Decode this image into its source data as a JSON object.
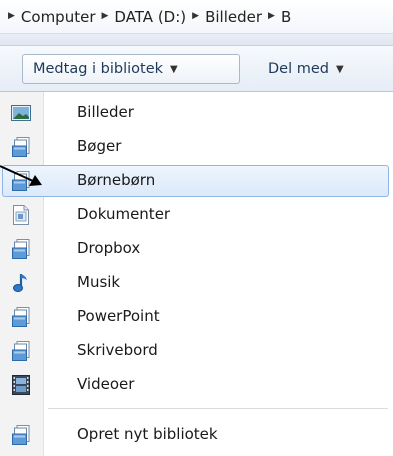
{
  "breadcrumb": {
    "items": [
      "Computer",
      "DATA (D:)",
      "Billeder",
      "B"
    ]
  },
  "toolbar": {
    "include_library_label": "Medtag i bibliotek",
    "share_label": "Del med"
  },
  "menu": {
    "items": [
      {
        "label": "Billeder",
        "icon": "pictures-library-icon"
      },
      {
        "label": "Bøger",
        "icon": "library-icon"
      },
      {
        "label": "Børnebørn",
        "icon": "library-icon"
      },
      {
        "label": "Dokumenter",
        "icon": "documents-library-icon"
      },
      {
        "label": "Dropbox",
        "icon": "library-icon"
      },
      {
        "label": "Musik",
        "icon": "music-library-icon"
      },
      {
        "label": "PowerPoint",
        "icon": "library-icon"
      },
      {
        "label": "Skrivebord",
        "icon": "library-icon"
      },
      {
        "label": "Videoer",
        "icon": "videos-library-icon"
      }
    ],
    "highlighted_item": "Børnebørn",
    "create_new_label": "Opret nyt bibliotek"
  },
  "colors": {
    "highlight_border": "#8fb6e4",
    "highlight_fill": "#dbe9fb",
    "toolbar_text": "#1e395b"
  }
}
